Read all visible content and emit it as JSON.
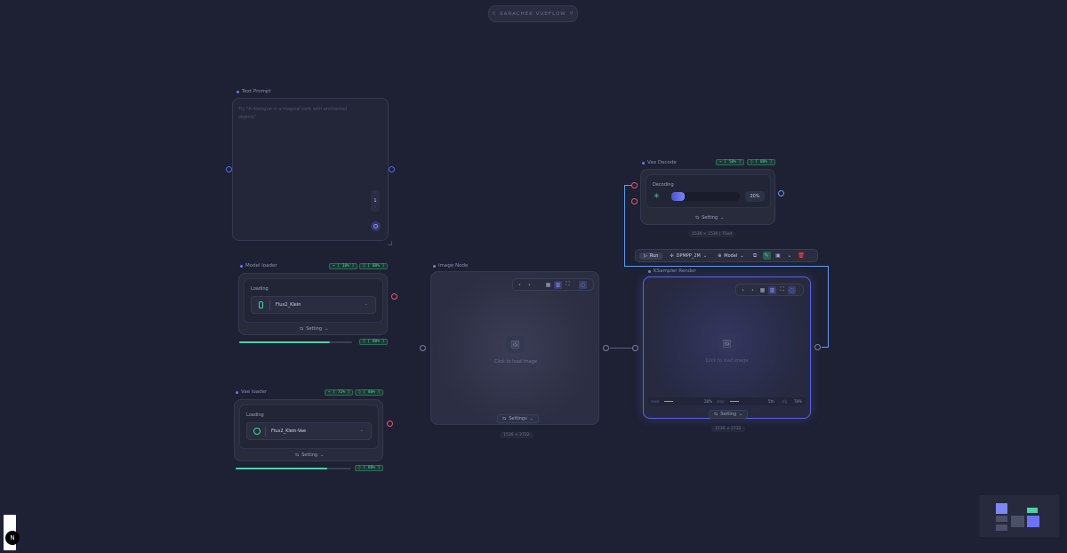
{
  "app": {
    "title": "KARACHEK VUEFLOW"
  },
  "text_prompt": {
    "label": "Text Prompt",
    "placeholder": "Try \"A dialogue in a magical cafe with enchanted objects\"",
    "counter_value": "1"
  },
  "model_loader": {
    "label": "Model loader",
    "badge_cpu": "⌁ [ 18% ]",
    "badge_mem": "◊ [ 88% ]",
    "loading_label": "Loading",
    "model_value": "Flux2_Klein",
    "setting_label": "Setting",
    "progress_badge": "◊ [ 88% ]",
    "progress": 0.8
  },
  "vae_loader": {
    "label": "Vae loader",
    "badge_cpu": "⌁ [ 72% ]",
    "badge_mem": "◊ [ 88% ]",
    "loading_label": "Loading",
    "model_value": "Flux2_Klein-Vae",
    "setting_label": "Setting",
    "progress_badge": "◊ [ 88% ]",
    "progress": 0.79
  },
  "image_node": {
    "label": "Image Node",
    "placeholder": "Click to load image",
    "settings_label": "Settings",
    "resolution": "1536 × 2732"
  },
  "vae_decode": {
    "label": "Vae Decode",
    "badge_cpu": "⌁ [ 58% ]",
    "badge_mem": "◊ [ 88% ]",
    "status": "Decoding",
    "percent": "20%",
    "progress": 0.2,
    "setting_label": "Setting",
    "info": "1536 × 1536 | 75ed"
  },
  "run_toolbar": {
    "run_label": "Run",
    "sampler_value": "DPMPP_2M",
    "model_label": "Model"
  },
  "ksampler": {
    "label": "KSampler Render",
    "placeholder": "Click to load image",
    "setting_label": "Setting",
    "resolution": "1536 × 2732",
    "stats": [
      {
        "key": "seed",
        "value": "28%"
      },
      {
        "key": "step",
        "value": "5th"
      },
      {
        "key": "cfg",
        "value": "78%"
      }
    ]
  },
  "colors": {
    "background": "#1e2133",
    "accent": "#6b74f5",
    "success": "#4fd1a5",
    "danger": "#e05b6f",
    "edge": "#5f9cf0"
  },
  "footer": {
    "badge": "N"
  }
}
